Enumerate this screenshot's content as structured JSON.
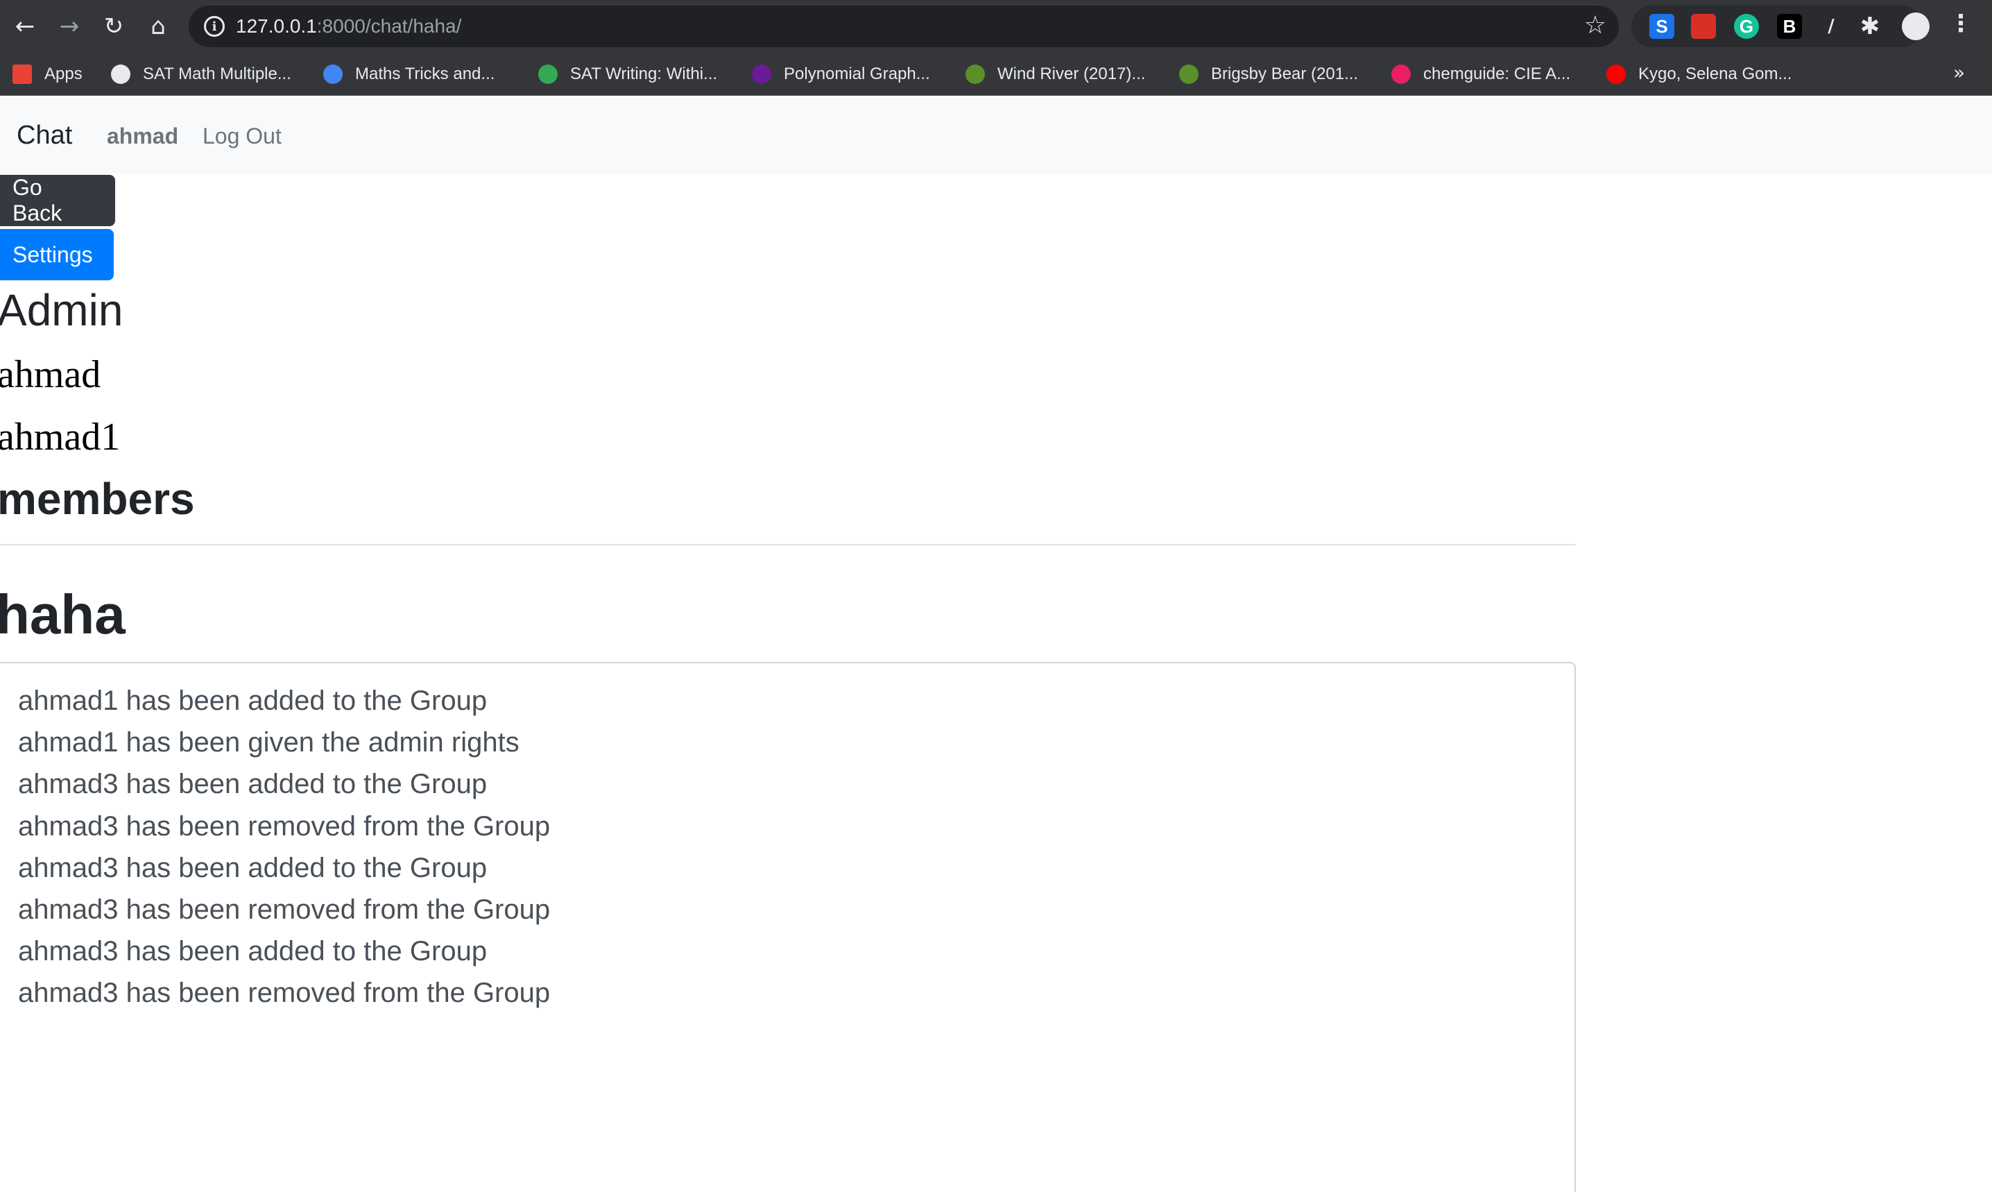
{
  "browser": {
    "url_host": "127.0.0.1",
    "url_rest": ":8000/chat/haha/",
    "bookmarks": [
      {
        "label": "Apps",
        "color": "#ea4335"
      },
      {
        "label": "SAT Math Multiple...",
        "color": "#e8eaed"
      },
      {
        "label": "Maths Tricks and...",
        "color": "#4285f4"
      },
      {
        "label": "SAT Writing: Withi...",
        "color": "#34a853"
      },
      {
        "label": "Polynomial Graph...",
        "color": "#6a1b9a"
      },
      {
        "label": "Wind River (2017)...",
        "color": "#5a8f29"
      },
      {
        "label": "Brigsby Bear (201...",
        "color": "#5a8f29"
      },
      {
        "label": "chemguide: CIE A...",
        "color": "#e91e63"
      },
      {
        "label": "Kygo, Selena Gom...",
        "color": "#ff0000"
      }
    ],
    "extensions": [
      {
        "name": "s-extension-icon",
        "glyph": "S",
        "bg": "#1a73e8",
        "fg": "#ffffff"
      },
      {
        "name": "pdf-extension-icon",
        "glyph": "",
        "bg": "#d93025",
        "fg": "#ffffff"
      },
      {
        "name": "grammarly-icon",
        "glyph": "G",
        "bg": "#15c39a",
        "fg": "#ffffff"
      },
      {
        "name": "b-extension-icon",
        "glyph": "B",
        "bg": "#000000",
        "fg": "#ffffff"
      }
    ]
  },
  "navbar": {
    "brand": "Chat",
    "user": "ahmad",
    "logout": "Log Out"
  },
  "buttons": {
    "go_back": "Go Back",
    "settings": "Settings"
  },
  "admin": {
    "heading": "Admin",
    "names": [
      "ahmad",
      "ahmad1"
    ]
  },
  "members": {
    "heading": "members"
  },
  "group": {
    "title": "haha",
    "messages": [
      "ahmad1 has been added to the Group",
      "ahmad1 has been given the admin rights",
      "ahmad3 has been added to the Group",
      "ahmad3 has been removed from the Group",
      "ahmad3 has been added to the Group",
      "ahmad3 has been removed from the Group",
      "ahmad3 has been added to the Group",
      "ahmad3 has been removed from the Group"
    ]
  }
}
